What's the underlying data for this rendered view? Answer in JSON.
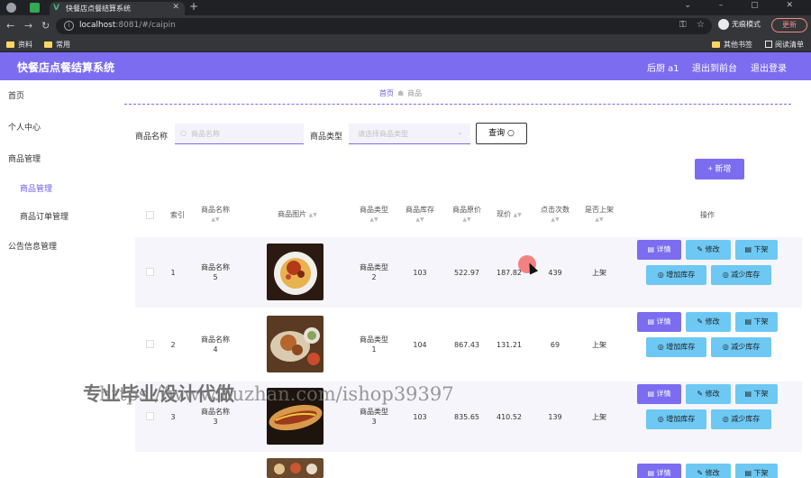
{
  "browser": {
    "tab_title": "快餐店点餐结算系统",
    "url_host": "localhost",
    "url_rest": ":8081/#/caipin",
    "incognito_label": "无痕模式",
    "update_label": "更新",
    "bookmarks": [
      "资料",
      "常用"
    ],
    "bookmarks_right": [
      "其他书签",
      "阅读清单"
    ]
  },
  "app": {
    "title": "快餐店点餐结算系统",
    "user": "后厨 a1",
    "back_label": "退出到前台",
    "logout_label": "退出登录"
  },
  "sidebar": {
    "home": "首页",
    "personal": "个人中心",
    "goods_mgmt": "商品管理",
    "goods_sub": "商品管理",
    "order_sub": "商品订单管理",
    "notice_mgmt": "公告信息管理"
  },
  "breadcrumb": {
    "home": "首页",
    "current": "商品"
  },
  "search": {
    "name_label": "商品名称",
    "name_placeholder": "商品名称",
    "type_label": "商品类型",
    "type_placeholder": "请选择商品类型",
    "query_label": "查询"
  },
  "add_label": "+ 新增",
  "table": {
    "headers": {
      "index": "索引",
      "name": "商品名称",
      "image": "商品图片",
      "type": "商品类型",
      "stock": "商品库存",
      "orig_price": "商品原价",
      "price": "现价",
      "clicks": "点击次数",
      "on_sale": "是否上架",
      "ops": "操作"
    },
    "rows": [
      {
        "index": "1",
        "name_a": "商品名称",
        "name_b": "5",
        "type_a": "商品类型",
        "type_b": "2",
        "stock": "103",
        "orig_price": "522.97",
        "price": "187.82",
        "clicks": "439",
        "on_sale": "上架"
      },
      {
        "index": "2",
        "name_a": "商品名称",
        "name_b": "4",
        "type_a": "商品类型",
        "type_b": "1",
        "stock": "104",
        "orig_price": "867.43",
        "price": "131.21",
        "clicks": "69",
        "on_sale": "上架"
      },
      {
        "index": "3",
        "name_a": "商品名称",
        "name_b": "3",
        "type_a": "商品类型",
        "type_b": "3",
        "stock": "103",
        "orig_price": "835.65",
        "price": "410.52",
        "clicks": "139",
        "on_sale": "上架"
      }
    ],
    "actions": {
      "detail": "详情",
      "edit": "修改",
      "offshelf": "下架",
      "add_stock": "增加库存",
      "reduce_stock": "减少库存"
    }
  },
  "watermark": {
    "cn": "专业毕业设计代做",
    "url": "https://www.huzhan.com/ishop39397"
  }
}
